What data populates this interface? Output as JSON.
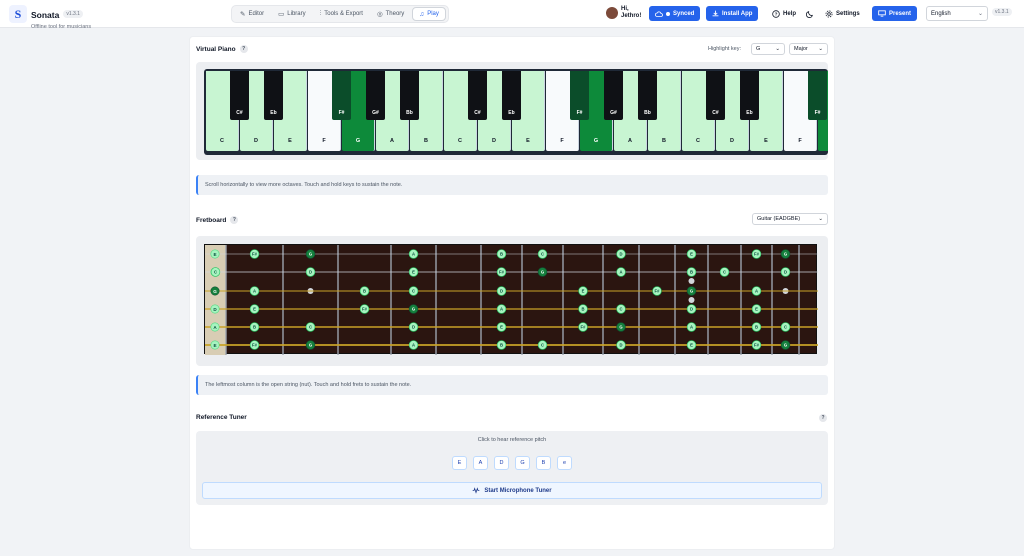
{
  "app": {
    "name": "Sonata",
    "version": "v1.3.1",
    "tagline": "Offline tool for musicians",
    "logo": "S"
  },
  "nav": {
    "tabs": [
      {
        "label": "Editor",
        "icon": "pencil-icon",
        "glyph": "✎",
        "active": false
      },
      {
        "label": "Library",
        "icon": "book-icon",
        "glyph": "▭",
        "active": false
      },
      {
        "label": "Tools & Export",
        "icon": "sliders-icon",
        "glyph": "⫶",
        "active": false
      },
      {
        "label": "Theory",
        "icon": "palette-icon",
        "glyph": "◎",
        "active": false
      },
      {
        "label": "Play",
        "icon": "music-note-icon",
        "glyph": "♫",
        "active": true
      }
    ]
  },
  "user": {
    "greeting_line1": "Hi,",
    "greeting_line2": "Jethro!"
  },
  "header": {
    "synced": "Synced",
    "install": "Install App",
    "help": "Help",
    "theme_icon": "moon-icon",
    "settings": "Settings",
    "present": "Present",
    "language": "English",
    "version_badge": "v1.3.1"
  },
  "piano": {
    "title": "Virtual Piano",
    "help": "?",
    "highlight_label": "Highlight key:",
    "key_value": "G",
    "scale_value": "Major",
    "white_keys": [
      {
        "n": "C",
        "s": "in"
      },
      {
        "n": "D",
        "s": "in"
      },
      {
        "n": "E",
        "s": "in"
      },
      {
        "n": "F",
        "s": "out"
      },
      {
        "n": "G",
        "s": "root"
      },
      {
        "n": "A",
        "s": "in"
      },
      {
        "n": "B",
        "s": "in"
      },
      {
        "n": "C",
        "s": "in"
      },
      {
        "n": "D",
        "s": "in"
      },
      {
        "n": "E",
        "s": "in"
      },
      {
        "n": "F",
        "s": "out"
      },
      {
        "n": "G",
        "s": "root"
      },
      {
        "n": "A",
        "s": "in"
      },
      {
        "n": "B",
        "s": "in"
      },
      {
        "n": "C",
        "s": "in"
      },
      {
        "n": "D",
        "s": "in"
      },
      {
        "n": "E",
        "s": "in"
      },
      {
        "n": "F",
        "s": "out"
      },
      {
        "n": "G",
        "s": "root"
      }
    ],
    "black_keys": [
      {
        "n": "C#",
        "after": 0,
        "s": "out"
      },
      {
        "n": "Eb",
        "after": 1,
        "s": "out"
      },
      {
        "n": "F#",
        "after": 3,
        "s": "in"
      },
      {
        "n": "G#",
        "after": 4,
        "s": "out"
      },
      {
        "n": "Bb",
        "after": 5,
        "s": "out"
      },
      {
        "n": "C#",
        "after": 7,
        "s": "out"
      },
      {
        "n": "Eb",
        "after": 8,
        "s": "out"
      },
      {
        "n": "F#",
        "after": 10,
        "s": "in"
      },
      {
        "n": "G#",
        "after": 11,
        "s": "out"
      },
      {
        "n": "Bb",
        "after": 12,
        "s": "out"
      },
      {
        "n": "C#",
        "after": 14,
        "s": "out"
      },
      {
        "n": "Eb",
        "after": 15,
        "s": "out"
      },
      {
        "n": "F#",
        "after": 17,
        "s": "in"
      }
    ],
    "info": "Scroll horizontally to view more octaves. Touch and hold keys to sustain the note."
  },
  "fretboard": {
    "title": "Fretboard",
    "help": "?",
    "instrument": "Guitar (EADGBE)",
    "open_strings": [
      {
        "n": "E",
        "root": false
      },
      {
        "n": "B",
        "root": false
      },
      {
        "n": "G",
        "root": true
      },
      {
        "n": "D",
        "root": false
      },
      {
        "n": "A",
        "root": false
      },
      {
        "n": "E",
        "root": false
      }
    ],
    "notes": [
      {
        "str": 0,
        "fret": 2,
        "n": "F#",
        "root": false
      },
      {
        "str": 0,
        "fret": 3,
        "n": "G",
        "root": true
      },
      {
        "str": 0,
        "fret": 5,
        "n": "A",
        "root": false
      },
      {
        "str": 0,
        "fret": 7,
        "n": "B",
        "root": false
      },
      {
        "str": 0,
        "fret": 8,
        "n": "C",
        "root": false
      },
      {
        "str": 0,
        "fret": 10,
        "n": "D",
        "root": false
      },
      {
        "str": 0,
        "fret": 12,
        "n": "E",
        "root": false
      },
      {
        "str": 0,
        "fret": 14,
        "n": "F#",
        "root": false
      },
      {
        "str": 0,
        "fret": 15,
        "n": "G",
        "root": true
      },
      {
        "str": 1,
        "fret": 1,
        "n": "C",
        "root": false
      },
      {
        "str": 1,
        "fret": 3,
        "n": "D",
        "root": false
      },
      {
        "str": 1,
        "fret": 5,
        "n": "E",
        "root": false
      },
      {
        "str": 1,
        "fret": 7,
        "n": "F#",
        "root": false
      },
      {
        "str": 1,
        "fret": 8,
        "n": "G",
        "root": true
      },
      {
        "str": 1,
        "fret": 10,
        "n": "A",
        "root": false
      },
      {
        "str": 1,
        "fret": 12,
        "n": "B",
        "root": false
      },
      {
        "str": 1,
        "fret": 13,
        "n": "C",
        "root": false
      },
      {
        "str": 1,
        "fret": 15,
        "n": "D",
        "root": false
      },
      {
        "str": 2,
        "fret": 2,
        "n": "A",
        "root": false
      },
      {
        "str": 2,
        "fret": 4,
        "n": "B",
        "root": false
      },
      {
        "str": 2,
        "fret": 5,
        "n": "C",
        "root": false
      },
      {
        "str": 2,
        "fret": 7,
        "n": "D",
        "root": false
      },
      {
        "str": 2,
        "fret": 9,
        "n": "E",
        "root": false
      },
      {
        "str": 2,
        "fret": 11,
        "n": "F#",
        "root": false
      },
      {
        "str": 2,
        "fret": 12,
        "n": "G",
        "root": true
      },
      {
        "str": 2,
        "fret": 14,
        "n": "A",
        "root": false
      },
      {
        "str": 3,
        "fret": 2,
        "n": "E",
        "root": false
      },
      {
        "str": 3,
        "fret": 4,
        "n": "F#",
        "root": false
      },
      {
        "str": 3,
        "fret": 5,
        "n": "G",
        "root": true
      },
      {
        "str": 3,
        "fret": 7,
        "n": "A",
        "root": false
      },
      {
        "str": 3,
        "fret": 9,
        "n": "B",
        "root": false
      },
      {
        "str": 3,
        "fret": 10,
        "n": "C",
        "root": false
      },
      {
        "str": 3,
        "fret": 12,
        "n": "D",
        "root": false
      },
      {
        "str": 3,
        "fret": 14,
        "n": "E",
        "root": false
      },
      {
        "str": 4,
        "fret": 2,
        "n": "B",
        "root": false
      },
      {
        "str": 4,
        "fret": 3,
        "n": "C",
        "root": false
      },
      {
        "str": 4,
        "fret": 5,
        "n": "D",
        "root": false
      },
      {
        "str": 4,
        "fret": 7,
        "n": "E",
        "root": false
      },
      {
        "str": 4,
        "fret": 9,
        "n": "F#",
        "root": false
      },
      {
        "str": 4,
        "fret": 10,
        "n": "G",
        "root": true
      },
      {
        "str": 4,
        "fret": 12,
        "n": "A",
        "root": false
      },
      {
        "str": 4,
        "fret": 14,
        "n": "B",
        "root": false
      },
      {
        "str": 4,
        "fret": 15,
        "n": "C",
        "root": false
      },
      {
        "str": 5,
        "fret": 2,
        "n": "F#",
        "root": false
      },
      {
        "str": 5,
        "fret": 3,
        "n": "G",
        "root": true
      },
      {
        "str": 5,
        "fret": 5,
        "n": "A",
        "root": false
      },
      {
        "str": 5,
        "fret": 7,
        "n": "B",
        "root": false
      },
      {
        "str": 5,
        "fret": 8,
        "n": "C",
        "root": false
      },
      {
        "str": 5,
        "fret": 10,
        "n": "D",
        "root": false
      },
      {
        "str": 5,
        "fret": 12,
        "n": "E",
        "root": false
      },
      {
        "str": 5,
        "fret": 14,
        "n": "F#",
        "root": false
      },
      {
        "str": 5,
        "fret": 15,
        "n": "G",
        "root": true
      }
    ],
    "inlay_frets": [
      3,
      5,
      7,
      9,
      12,
      15
    ],
    "info": "The leftmost column is the open string (nut). Touch and hold frets to sustain the note."
  },
  "tuner": {
    "title": "Reference Tuner",
    "help": "?",
    "hint": "Click to hear reference pitch",
    "pitches": [
      "E",
      "A",
      "D",
      "G",
      "B",
      "e"
    ],
    "mic_label": "Start Microphone Tuner",
    "mic_icon": "waveform-icon"
  },
  "colors": {
    "accent": "#2563eb",
    "scale_key": "#c8f5d2",
    "root_key": "#0d8a3a",
    "root_black": "#0b4d2a",
    "note_dot": "#a7f3c0",
    "root_dot": "#15803d"
  }
}
